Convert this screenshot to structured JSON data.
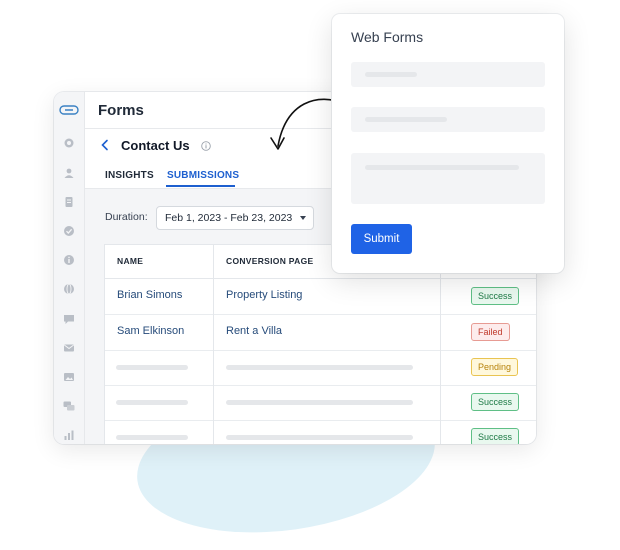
{
  "app": {
    "title": "Forms"
  },
  "header": {
    "page_title": "Contact Us"
  },
  "tabs": [
    {
      "label": "INSIGHTS",
      "active": false
    },
    {
      "label": "SUBMISSIONS",
      "active": true
    }
  ],
  "duration": {
    "label": "Duration:",
    "value": "Feb 1, 2023 - Feb 23, 2023"
  },
  "table": {
    "columns": [
      "NAME",
      "CONVERSION PAGE"
    ],
    "rows": [
      {
        "name": "Brian Simons",
        "page": "Property Listing",
        "status": "Success"
      },
      {
        "name": "Sam Elkinson",
        "page": "Rent a Villa",
        "status": "Failed"
      },
      {
        "name": "",
        "page": "",
        "status": "Pending"
      },
      {
        "name": "",
        "page": "",
        "status": "Success"
      },
      {
        "name": "",
        "page": "",
        "status": "Success"
      }
    ]
  },
  "popup": {
    "title": "Web Forms",
    "submit_label": "Submit"
  },
  "colors": {
    "accent": "#1f63e6",
    "tab_active": "#1d5fcf",
    "success": "#1e7a46",
    "failed": "#c0392b",
    "pending": "#b7830b"
  },
  "icons": {
    "rail": [
      "dashboard-icon",
      "user-icon",
      "document-icon",
      "check-circle-icon",
      "info-circle-icon",
      "globe-icon",
      "chat-icon",
      "mail-icon",
      "image-icon",
      "chat-bubbles-icon",
      "bar-chart-icon"
    ]
  }
}
